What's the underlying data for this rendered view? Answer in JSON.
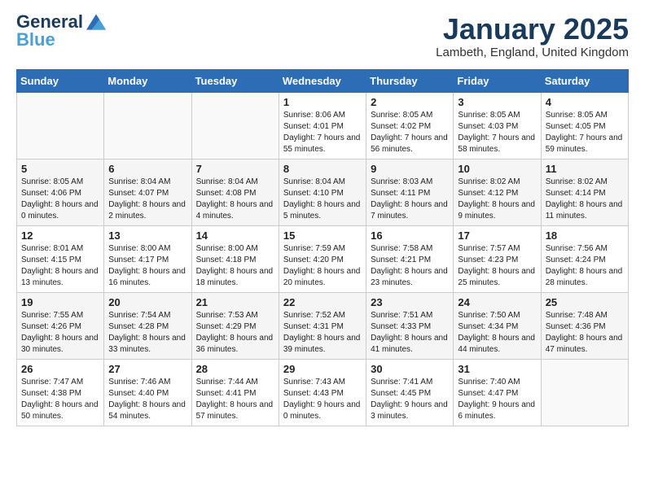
{
  "header": {
    "logo_general": "General",
    "logo_blue": "Blue",
    "title": "January 2025",
    "location": "Lambeth, England, United Kingdom"
  },
  "weekdays": [
    "Sunday",
    "Monday",
    "Tuesday",
    "Wednesday",
    "Thursday",
    "Friday",
    "Saturday"
  ],
  "weeks": [
    [
      {
        "day": "",
        "content": ""
      },
      {
        "day": "",
        "content": ""
      },
      {
        "day": "",
        "content": ""
      },
      {
        "day": "1",
        "content": "Sunrise: 8:06 AM\nSunset: 4:01 PM\nDaylight: 7 hours and 55 minutes."
      },
      {
        "day": "2",
        "content": "Sunrise: 8:05 AM\nSunset: 4:02 PM\nDaylight: 7 hours and 56 minutes."
      },
      {
        "day": "3",
        "content": "Sunrise: 8:05 AM\nSunset: 4:03 PM\nDaylight: 7 hours and 58 minutes."
      },
      {
        "day": "4",
        "content": "Sunrise: 8:05 AM\nSunset: 4:05 PM\nDaylight: 7 hours and 59 minutes."
      }
    ],
    [
      {
        "day": "5",
        "content": "Sunrise: 8:05 AM\nSunset: 4:06 PM\nDaylight: 8 hours and 0 minutes."
      },
      {
        "day": "6",
        "content": "Sunrise: 8:04 AM\nSunset: 4:07 PM\nDaylight: 8 hours and 2 minutes."
      },
      {
        "day": "7",
        "content": "Sunrise: 8:04 AM\nSunset: 4:08 PM\nDaylight: 8 hours and 4 minutes."
      },
      {
        "day": "8",
        "content": "Sunrise: 8:04 AM\nSunset: 4:10 PM\nDaylight: 8 hours and 5 minutes."
      },
      {
        "day": "9",
        "content": "Sunrise: 8:03 AM\nSunset: 4:11 PM\nDaylight: 8 hours and 7 minutes."
      },
      {
        "day": "10",
        "content": "Sunrise: 8:02 AM\nSunset: 4:12 PM\nDaylight: 8 hours and 9 minutes."
      },
      {
        "day": "11",
        "content": "Sunrise: 8:02 AM\nSunset: 4:14 PM\nDaylight: 8 hours and 11 minutes."
      }
    ],
    [
      {
        "day": "12",
        "content": "Sunrise: 8:01 AM\nSunset: 4:15 PM\nDaylight: 8 hours and 13 minutes."
      },
      {
        "day": "13",
        "content": "Sunrise: 8:00 AM\nSunset: 4:17 PM\nDaylight: 8 hours and 16 minutes."
      },
      {
        "day": "14",
        "content": "Sunrise: 8:00 AM\nSunset: 4:18 PM\nDaylight: 8 hours and 18 minutes."
      },
      {
        "day": "15",
        "content": "Sunrise: 7:59 AM\nSunset: 4:20 PM\nDaylight: 8 hours and 20 minutes."
      },
      {
        "day": "16",
        "content": "Sunrise: 7:58 AM\nSunset: 4:21 PM\nDaylight: 8 hours and 23 minutes."
      },
      {
        "day": "17",
        "content": "Sunrise: 7:57 AM\nSunset: 4:23 PM\nDaylight: 8 hours and 25 minutes."
      },
      {
        "day": "18",
        "content": "Sunrise: 7:56 AM\nSunset: 4:24 PM\nDaylight: 8 hours and 28 minutes."
      }
    ],
    [
      {
        "day": "19",
        "content": "Sunrise: 7:55 AM\nSunset: 4:26 PM\nDaylight: 8 hours and 30 minutes."
      },
      {
        "day": "20",
        "content": "Sunrise: 7:54 AM\nSunset: 4:28 PM\nDaylight: 8 hours and 33 minutes."
      },
      {
        "day": "21",
        "content": "Sunrise: 7:53 AM\nSunset: 4:29 PM\nDaylight: 8 hours and 36 minutes."
      },
      {
        "day": "22",
        "content": "Sunrise: 7:52 AM\nSunset: 4:31 PM\nDaylight: 8 hours and 39 minutes."
      },
      {
        "day": "23",
        "content": "Sunrise: 7:51 AM\nSunset: 4:33 PM\nDaylight: 8 hours and 41 minutes."
      },
      {
        "day": "24",
        "content": "Sunrise: 7:50 AM\nSunset: 4:34 PM\nDaylight: 8 hours and 44 minutes."
      },
      {
        "day": "25",
        "content": "Sunrise: 7:48 AM\nSunset: 4:36 PM\nDaylight: 8 hours and 47 minutes."
      }
    ],
    [
      {
        "day": "26",
        "content": "Sunrise: 7:47 AM\nSunset: 4:38 PM\nDaylight: 8 hours and 50 minutes."
      },
      {
        "day": "27",
        "content": "Sunrise: 7:46 AM\nSunset: 4:40 PM\nDaylight: 8 hours and 54 minutes."
      },
      {
        "day": "28",
        "content": "Sunrise: 7:44 AM\nSunset: 4:41 PM\nDaylight: 8 hours and 57 minutes."
      },
      {
        "day": "29",
        "content": "Sunrise: 7:43 AM\nSunset: 4:43 PM\nDaylight: 9 hours and 0 minutes."
      },
      {
        "day": "30",
        "content": "Sunrise: 7:41 AM\nSunset: 4:45 PM\nDaylight: 9 hours and 3 minutes."
      },
      {
        "day": "31",
        "content": "Sunrise: 7:40 AM\nSunset: 4:47 PM\nDaylight: 9 hours and 6 minutes."
      },
      {
        "day": "",
        "content": ""
      }
    ]
  ]
}
